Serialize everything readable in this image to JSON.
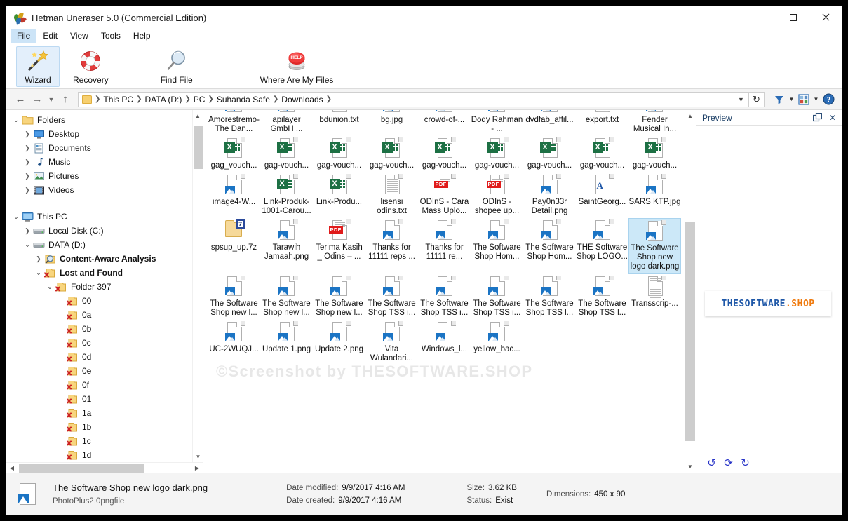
{
  "window": {
    "title": "Hetman Uneraser 5.0 (Commercial Edition)",
    "icon": "hetman-app-icon",
    "controls": {
      "minimize": "minimize-icon",
      "maximize": "maximize-icon",
      "close": "close-icon"
    }
  },
  "menubar": {
    "items": [
      "File",
      "Edit",
      "View",
      "Tools",
      "Help"
    ],
    "active_index": 0
  },
  "toolbar": {
    "buttons": [
      {
        "label": "Wizard",
        "icon": "magic-wand-icon",
        "selected": true
      },
      {
        "label": "Recovery",
        "icon": "lifebuoy-icon",
        "selected": false
      },
      {
        "label": "Find File",
        "icon": "magnifier-icon",
        "selected": false
      },
      {
        "label": "Where Are My Files",
        "icon": "red-help-button-icon",
        "selected": false
      }
    ]
  },
  "addressbar": {
    "back": "back-arrow-icon",
    "forward": "forward-arrow-icon",
    "history": "history-chevron-icon",
    "up": "up-arrow-icon",
    "folder_icon": "folder-icon",
    "breadcrumbs": [
      "This PC",
      "DATA (D:)",
      "PC",
      "Suhanda Safe",
      "Downloads"
    ],
    "dropdown": "chevron-down-icon",
    "refresh": "refresh-icon",
    "filter": "filter-funnel-icon",
    "view_mode": "view-mode-icon",
    "help": "help-icon"
  },
  "sidebar": {
    "nodes": [
      {
        "label": "Folders",
        "depth": 0,
        "state": "open",
        "icon": "folder-icon",
        "bold": false
      },
      {
        "label": "Desktop",
        "depth": 1,
        "state": "closed",
        "icon": "desktop-icon",
        "bold": false
      },
      {
        "label": "Documents",
        "depth": 1,
        "state": "closed",
        "icon": "documents-icon",
        "bold": false
      },
      {
        "label": "Music",
        "depth": 1,
        "state": "closed",
        "icon": "music-note-icon",
        "bold": false
      },
      {
        "label": "Pictures",
        "depth": 1,
        "state": "closed",
        "icon": "pictures-icon",
        "bold": false
      },
      {
        "label": "Videos",
        "depth": 1,
        "state": "closed",
        "icon": "videos-icon",
        "bold": false
      },
      {
        "label": "",
        "depth": 0,
        "state": "none",
        "icon": "spacer",
        "bold": false
      },
      {
        "label": "This PC",
        "depth": 0,
        "state": "open",
        "icon": "this-pc-icon",
        "bold": false
      },
      {
        "label": "Local Disk (C:)",
        "depth": 1,
        "state": "closed",
        "icon": "drive-icon",
        "bold": false
      },
      {
        "label": "DATA (D:)",
        "depth": 1,
        "state": "open",
        "icon": "drive-icon",
        "bold": false
      },
      {
        "label": "Content-Aware Analysis",
        "depth": 2,
        "state": "closed",
        "icon": "magnifier-icon",
        "bold": true
      },
      {
        "label": "Lost and Found",
        "depth": 2,
        "state": "open",
        "icon": "deleted-folder-icon",
        "bold": true
      },
      {
        "label": "Folder 397",
        "depth": 3,
        "state": "open",
        "icon": "deleted-folder-icon",
        "bold": false
      },
      {
        "label": "00",
        "depth": 4,
        "state": "none",
        "icon": "deleted-folder-icon",
        "bold": false
      },
      {
        "label": "0a",
        "depth": 4,
        "state": "none",
        "icon": "deleted-folder-icon",
        "bold": false
      },
      {
        "label": "0b",
        "depth": 4,
        "state": "none",
        "icon": "deleted-folder-icon",
        "bold": false
      },
      {
        "label": "0c",
        "depth": 4,
        "state": "none",
        "icon": "deleted-folder-icon",
        "bold": false
      },
      {
        "label": "0d",
        "depth": 4,
        "state": "none",
        "icon": "deleted-folder-icon",
        "bold": false
      },
      {
        "label": "0e",
        "depth": 4,
        "state": "none",
        "icon": "deleted-folder-icon",
        "bold": false
      },
      {
        "label": "0f",
        "depth": 4,
        "state": "none",
        "icon": "deleted-folder-icon",
        "bold": false
      },
      {
        "label": "01",
        "depth": 4,
        "state": "none",
        "icon": "deleted-folder-icon",
        "bold": false
      },
      {
        "label": "1a",
        "depth": 4,
        "state": "none",
        "icon": "deleted-folder-icon",
        "bold": false
      },
      {
        "label": "1b",
        "depth": 4,
        "state": "none",
        "icon": "deleted-folder-icon",
        "bold": false
      },
      {
        "label": "1c",
        "depth": 4,
        "state": "none",
        "icon": "deleted-folder-icon",
        "bold": false
      },
      {
        "label": "1d",
        "depth": 4,
        "state": "none",
        "icon": "deleted-folder-icon",
        "bold": false
      }
    ]
  },
  "files": {
    "watermark": "©Screenshot by THESOFTWARE.SHOP",
    "items": [
      {
        "name": "Amorestremo-The Dan...",
        "type": "image",
        "selected": false
      },
      {
        "name": "apilayer GmbH ...",
        "type": "image",
        "selected": false
      },
      {
        "name": "bdunion.txt",
        "type": "text",
        "selected": false
      },
      {
        "name": "bg.jpg",
        "type": "image",
        "selected": false
      },
      {
        "name": "crowd-of-...",
        "type": "image",
        "selected": false
      },
      {
        "name": "Dody Rahman - ...",
        "type": "image",
        "selected": false
      },
      {
        "name": "dvdfab_affil...",
        "type": "image",
        "selected": false
      },
      {
        "name": "export.txt",
        "type": "text",
        "selected": false
      },
      {
        "name": "Fender Musical In...",
        "type": "image",
        "selected": false
      },
      {
        "name": "gag_vouch...",
        "type": "excel",
        "selected": false
      },
      {
        "name": "gag-vouch...",
        "type": "excel",
        "selected": false
      },
      {
        "name": "gag-vouch...",
        "type": "excel",
        "selected": false
      },
      {
        "name": "gag-vouch...",
        "type": "excel",
        "selected": false
      },
      {
        "name": "gag-vouch...",
        "type": "excel",
        "selected": false
      },
      {
        "name": "gag-vouch...",
        "type": "excel",
        "selected": false
      },
      {
        "name": "gag-vouch...",
        "type": "excel",
        "selected": false
      },
      {
        "name": "gag-vouch...",
        "type": "excel",
        "selected": false
      },
      {
        "name": "gag-vouch...",
        "type": "excel",
        "selected": false
      },
      {
        "name": "image4-W...",
        "type": "image",
        "selected": false
      },
      {
        "name": "Link-Produk-1001-Carou...",
        "type": "excel",
        "selected": false
      },
      {
        "name": "Link-Produ...",
        "type": "excel",
        "selected": false
      },
      {
        "name": "lisensi odins.txt",
        "type": "text",
        "selected": false
      },
      {
        "name": "ODInS - Cara Mass Uplo...",
        "type": "pdf",
        "selected": false
      },
      {
        "name": "ODInS - shopee up...",
        "type": "pdf",
        "selected": false
      },
      {
        "name": "Pay0n33r Detail.png",
        "type": "image",
        "selected": false
      },
      {
        "name": "SaintGeorg...",
        "type": "font",
        "selected": false
      },
      {
        "name": "SARS KTP.jpg",
        "type": "image",
        "selected": false
      },
      {
        "name": "spsup_up.7z",
        "type": "archive",
        "selected": false
      },
      {
        "name": "Tarawih Jamaah.png",
        "type": "image",
        "selected": false
      },
      {
        "name": "Terima Kasih _ Odins – ...",
        "type": "pdf",
        "selected": false
      },
      {
        "name": "Thanks for 11111 reps ...",
        "type": "image",
        "selected": false
      },
      {
        "name": "Thanks for 11111 re...",
        "type": "image",
        "selected": false
      },
      {
        "name": "The Software Shop Hom...",
        "type": "image",
        "selected": false
      },
      {
        "name": "The Software Shop Hom...",
        "type": "image",
        "selected": false
      },
      {
        "name": "THE Software Shop LOGO...",
        "type": "image",
        "selected": false
      },
      {
        "name": "The Software Shop new logo dark.png",
        "type": "image",
        "selected": true
      },
      {
        "name": "The Software Shop new l...",
        "type": "image",
        "selected": false
      },
      {
        "name": "The Software Shop new l...",
        "type": "image",
        "selected": false
      },
      {
        "name": "The Software Shop new l...",
        "type": "image",
        "selected": false
      },
      {
        "name": "The Software Shop TSS i...",
        "type": "image",
        "selected": false
      },
      {
        "name": "The Software Shop TSS i...",
        "type": "image",
        "selected": false
      },
      {
        "name": "The Software Shop TSS i...",
        "type": "image",
        "selected": false
      },
      {
        "name": "The Software Shop TSS l...",
        "type": "image",
        "selected": false
      },
      {
        "name": "The Software Shop TSS l...",
        "type": "image",
        "selected": false
      },
      {
        "name": "Transscrip-...",
        "type": "text",
        "selected": false
      },
      {
        "name": "UC-2WUQJ...",
        "type": "image",
        "selected": false
      },
      {
        "name": "Update 1.png",
        "type": "image",
        "selected": false
      },
      {
        "name": "Update 2.png",
        "type": "image",
        "selected": false
      },
      {
        "name": "Vita Wulandari...",
        "type": "image",
        "selected": false
      },
      {
        "name": "Windows_l...",
        "type": "image",
        "selected": false
      },
      {
        "name": "yellow_bac...",
        "type": "image",
        "selected": false
      }
    ]
  },
  "preview": {
    "title": "Preview",
    "undock_icon": "undock-icon",
    "close_icon": "close-icon",
    "logo_primary": "THESOFTWARE",
    "logo_accent": ".SHOP",
    "rotate_left": "rotate-left-icon",
    "flip": "flip-icon",
    "rotate_right": "rotate-right-icon",
    "colors": {
      "logo_primary": "#1f58a8",
      "logo_accent": "#ef7b10"
    }
  },
  "statusbar": {
    "icon": "image-file-icon",
    "filename": "The Software Shop new logo dark.png",
    "filetype": "PhotoPlus2.0pngfile",
    "date_modified_label": "Date modified:",
    "date_modified": "9/9/2017 4:16 AM",
    "date_created_label": "Date created:",
    "date_created": "9/9/2017 4:16 AM",
    "size_label": "Size:",
    "size": "3.62 KB",
    "status_label": "Status:",
    "status": "Exist",
    "dimensions_label": "Dimensions:",
    "dimensions": "450 x 90"
  }
}
